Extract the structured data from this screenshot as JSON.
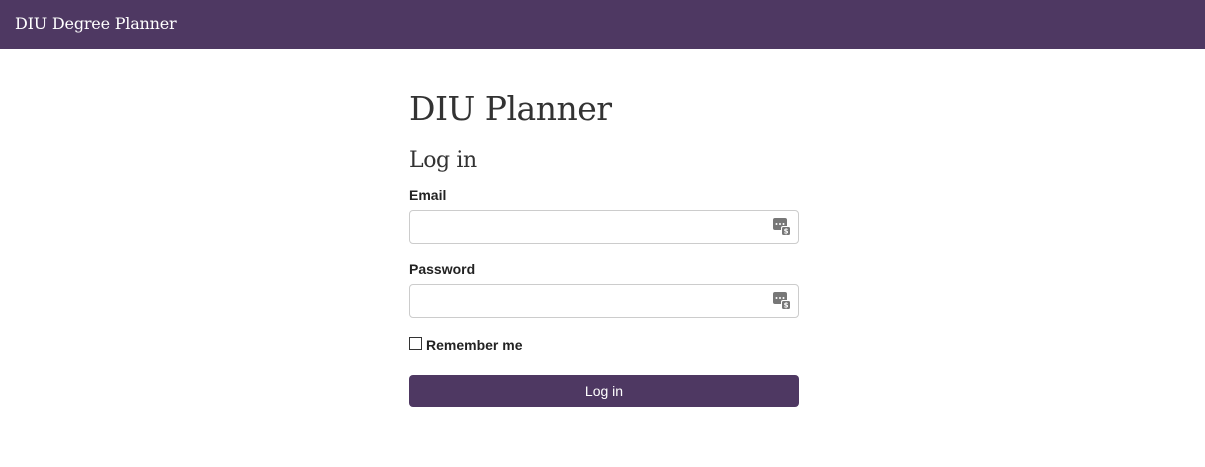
{
  "navbar": {
    "brand": "DIU Degree Planner"
  },
  "page": {
    "title": "DIU Planner",
    "subtitle": "Log in"
  },
  "form": {
    "email_label": "Email",
    "email_value": "",
    "password_label": "Password",
    "password_value": "",
    "remember_label": "Remember me",
    "remember_checked": false,
    "submit_label": "Log in",
    "field_icon": "password-manager-icon"
  },
  "colors": {
    "brand": "#4e3862",
    "text": "#333333",
    "input_border": "#cccccc"
  }
}
